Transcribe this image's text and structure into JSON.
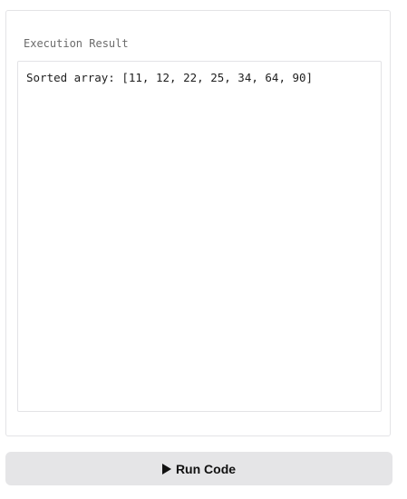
{
  "result_panel": {
    "label": "Execution Result",
    "output": "Sorted array: [11, 12, 22, 25, 34, 64, 90]"
  },
  "run_button": {
    "label": "Run Code",
    "icon": "play-icon"
  }
}
